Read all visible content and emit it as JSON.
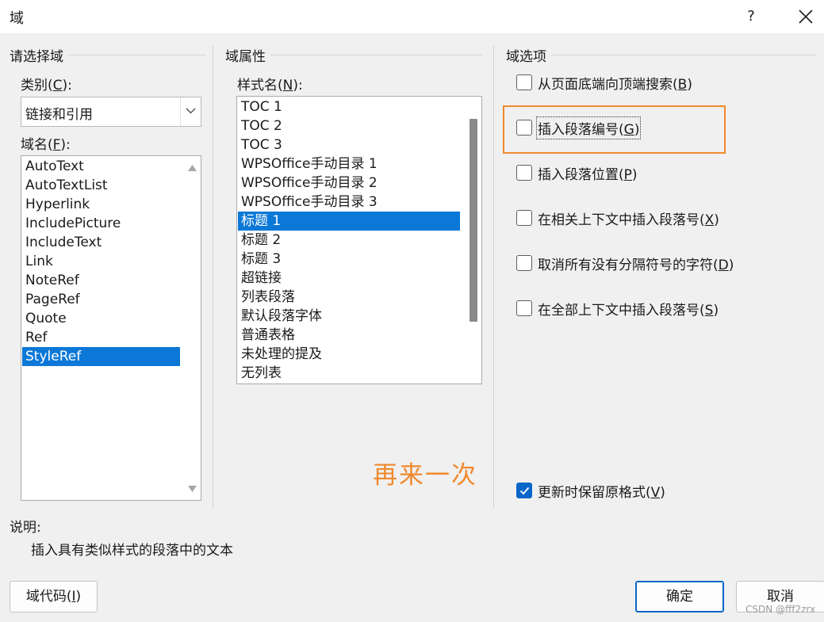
{
  "window": {
    "title": "域",
    "help_label": "?",
    "close_icon": "close-icon"
  },
  "left_panel": {
    "group_title": "请选择域",
    "category_label": "类别(",
    "category_key": "C",
    "category_suffix": "):",
    "category_value": "链接和引用",
    "field_name_label": "域名(",
    "field_name_key": "F",
    "field_name_suffix": "):",
    "field_names": [
      {
        "label": "AutoText",
        "selected": false
      },
      {
        "label": "AutoTextList",
        "selected": false
      },
      {
        "label": "Hyperlink",
        "selected": false
      },
      {
        "label": "IncludePicture",
        "selected": false
      },
      {
        "label": "IncludeText",
        "selected": false
      },
      {
        "label": "Link",
        "selected": false
      },
      {
        "label": "NoteRef",
        "selected": false
      },
      {
        "label": "PageRef",
        "selected": false
      },
      {
        "label": "Quote",
        "selected": false
      },
      {
        "label": "Ref",
        "selected": false
      },
      {
        "label": "StyleRef",
        "selected": true
      }
    ]
  },
  "middle_panel": {
    "group_title": "域属性",
    "style_name_label": "样式名(",
    "style_name_key": "N",
    "style_name_suffix": "):",
    "styles": [
      {
        "label": "TOC 1",
        "selected": false
      },
      {
        "label": "TOC 2",
        "selected": false
      },
      {
        "label": "TOC 3",
        "selected": false
      },
      {
        "label": "WPSOffice手动目录 1",
        "selected": false
      },
      {
        "label": "WPSOffice手动目录 2",
        "selected": false
      },
      {
        "label": "WPSOffice手动目录 3",
        "selected": false
      },
      {
        "label": "标题 1",
        "selected": true
      },
      {
        "label": "标题 2",
        "selected": false
      },
      {
        "label": "标题 3",
        "selected": false
      },
      {
        "label": "超链接",
        "selected": false
      },
      {
        "label": "列表段落",
        "selected": false
      },
      {
        "label": "默认段落字体",
        "selected": false
      },
      {
        "label": "普通表格",
        "selected": false
      },
      {
        "label": "未处理的提及",
        "selected": false
      },
      {
        "label": "无列表",
        "selected": false
      }
    ]
  },
  "right_panel": {
    "group_title": "域选项",
    "options": [
      {
        "text": "从页面底端向顶端搜索(",
        "key": "B",
        "end": ")",
        "checked": false
      },
      {
        "text": "插入段落编号(",
        "key": "G",
        "end": ")",
        "checked": false
      },
      {
        "text": "插入段落位置(",
        "key": "P",
        "end": ")",
        "checked": false
      },
      {
        "text": "在相关上下文中插入段落号(",
        "key": "X",
        "end": ")",
        "checked": false
      },
      {
        "text": "取消所有没有分隔符号的字符(",
        "key": "D",
        "end": ")",
        "checked": false
      },
      {
        "text": "在全部上下文中插入段落号(",
        "key": "S",
        "end": ")",
        "checked": false
      }
    ],
    "preserve_format": {
      "text": "更新时保留原格式(",
      "key": "V",
      "end": ")",
      "checked": true
    }
  },
  "annotation": {
    "text": "再来一次",
    "color": "#f0892d"
  },
  "description": {
    "label": "说明:",
    "text": "插入具有类似样式的段落中的文本"
  },
  "buttons": {
    "field_codes": {
      "text": "域代码(",
      "key": "I",
      "end": ")"
    },
    "ok": "确定",
    "cancel": "取消"
  },
  "watermark": "CSDN @fff2zrx",
  "colors": {
    "selection": "#0b78d7",
    "highlight_border": "#f08a2c",
    "checkbox_checked": "#0b66c9"
  }
}
